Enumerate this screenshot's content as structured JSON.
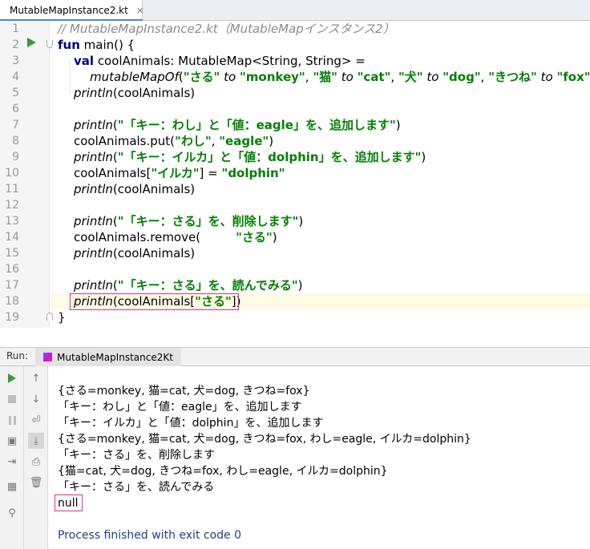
{
  "editor_tab": {
    "filename": "MutableMapInstance2.kt",
    "close": "×"
  },
  "line_numbers": [
    "1",
    "2",
    "3",
    "4",
    "5",
    "6",
    "7",
    "8",
    "9",
    "10",
    "11",
    "12",
    "13",
    "14",
    "15",
    "16",
    "17",
    "18",
    "19"
  ],
  "code": {
    "l1": "// MutableMapInstance2.kt（MutableMapインスタンス2）",
    "l2_kw": "fun",
    "l2_rest": " main() {",
    "l3_kw": "val",
    "l3_rest": " coolAnimals: MutableMap<String, String> =",
    "l4_fn": "mutableMapOf",
    "l4_s1": "\"さる\"",
    "l4_to": "to",
    "l4_s2": "\"monkey\"",
    "l4_s3": "\"猫\"",
    "l4_s4": "\"cat\"",
    "l4_s5": "\"犬\"",
    "l4_s6": "\"dog\"",
    "l4_s7": "\"きつね\"",
    "l4_s8": "\"fox\"",
    "println": "println",
    "arg": "(coolAnimals)",
    "l7_str": "\"「キー：わし」と「値：eagle」を、追加します\"",
    "l8_pre": "coolAnimals.put(",
    "l8_s1": "\"わし\"",
    "l8_s2": "\"eagle\"",
    "l9_str": "\"「キー：イルカ」と「値：dolphin」を、追加します\"",
    "l10_pre": "coolAnimals[",
    "l10_s1": "\"イルカ\"",
    "l10_mid": "] = ",
    "l10_s2": "\"dolphin\"",
    "l13_str": "\"「キー：さる」を、削除します\"",
    "l14_pre": "coolAnimals.remove(",
    "l14_s": "\"さる\"",
    "l17_str": "\"「キー：さる」を、読んでみる\"",
    "l18_pre": "(coolAnimals[",
    "l18_s": "\"さる\"",
    "l18_post": "])",
    "l19": "}"
  },
  "run_panel": {
    "label": "Run:",
    "tab": "MutableMapInstance2Kt",
    "output": [
      "{さる=monkey, 猫=cat, 犬=dog, きつね=fox}",
      "「キー：わし」と「値：eagle」を、追加します",
      "「キー：イルカ」と「値：dolphin」を、追加します",
      "{さる=monkey, 猫=cat, 犬=dog, きつね=fox, わし=eagle, イルカ=dolphin}",
      "「キー：さる」を、削除します",
      "{猫=cat, 犬=dog, きつね=fox, わし=eagle, イルカ=dolphin}",
      "「キー：さる」を、読んでみる",
      "null"
    ],
    "exit": "Process finished with exit code 0"
  },
  "icons": [
    "kotlin-file-icon",
    "run-icon",
    "stop-icon",
    "pause-icon",
    "camera-icon",
    "login-icon",
    "layout-icon",
    "pin-icon",
    "up-arrow-icon",
    "down-arrow-icon",
    "soft-wrap-icon",
    "scroll-end-icon",
    "print-icon",
    "trash-icon"
  ],
  "colors": {
    "keyword": "#000080",
    "string": "#008000",
    "comment": "#8c8c8c",
    "highlight_border": "#e0308f",
    "exit_text": "#1e3e8e"
  }
}
